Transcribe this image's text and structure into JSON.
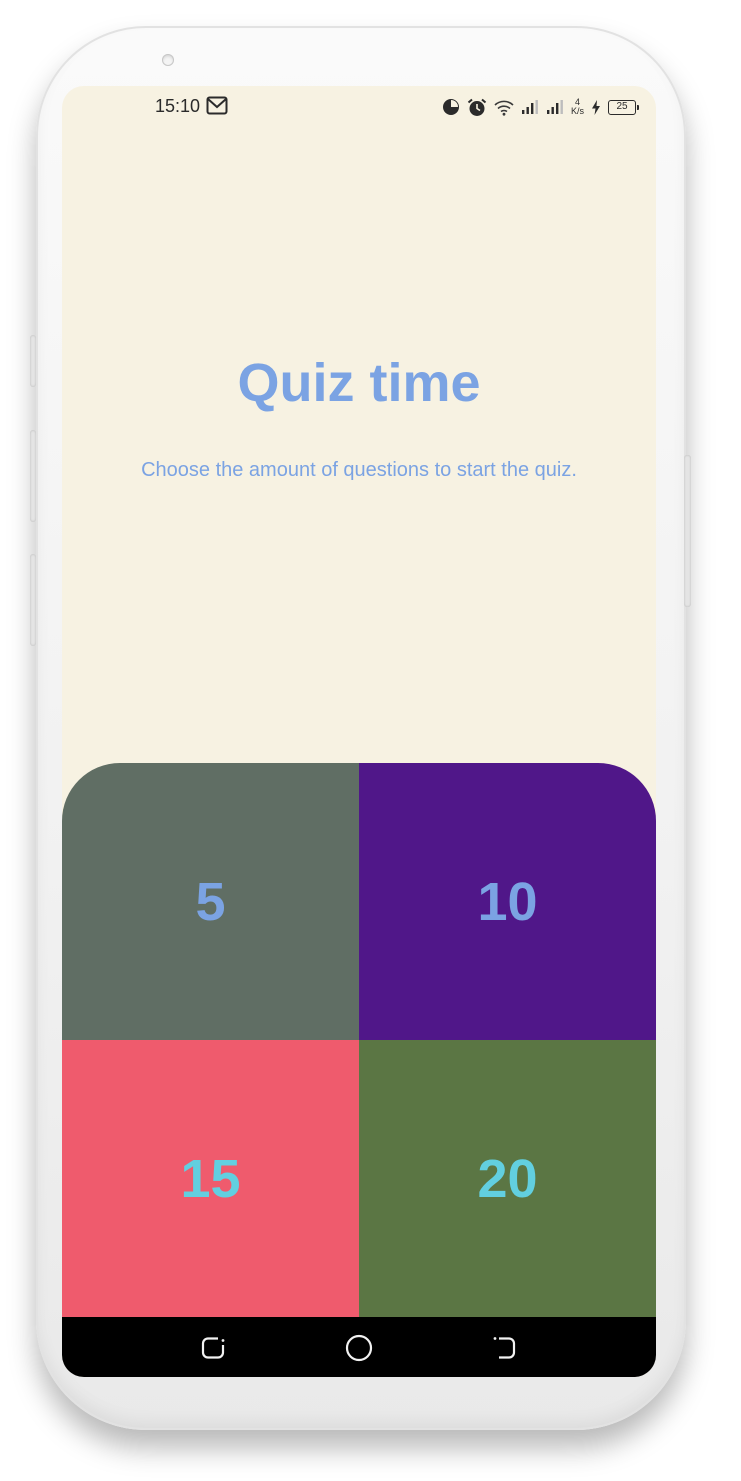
{
  "status_bar": {
    "time": "15:10",
    "network_speed_value": "4",
    "network_speed_unit": "K/s",
    "battery_level": "25",
    "icons": [
      "gmail-icon",
      "pie-chart-icon",
      "alarm-icon",
      "wifi-icon",
      "signal-1-icon",
      "signal-2-icon",
      "charging-icon",
      "battery-icon"
    ]
  },
  "main": {
    "title": "Quiz time",
    "subtitle": "Choose the amount of questions to start the quiz."
  },
  "options": [
    {
      "label": "5",
      "bg_color": "#606e64",
      "text_color": "#7ba3e3"
    },
    {
      "label": "10",
      "bg_color": "#501789",
      "text_color": "#7ba3e3"
    },
    {
      "label": "15",
      "bg_color": "#ef5b6d",
      "text_color": "#62cfe0"
    },
    {
      "label": "20",
      "bg_color": "#5b7644",
      "text_color": "#62cfe0"
    }
  ],
  "navigation_bar": {
    "buttons": [
      "recent-apps-icon",
      "home-icon",
      "back-icon"
    ]
  },
  "colors": {
    "screen_background": "#f7f2e2",
    "accent": "#7ba3e3"
  }
}
